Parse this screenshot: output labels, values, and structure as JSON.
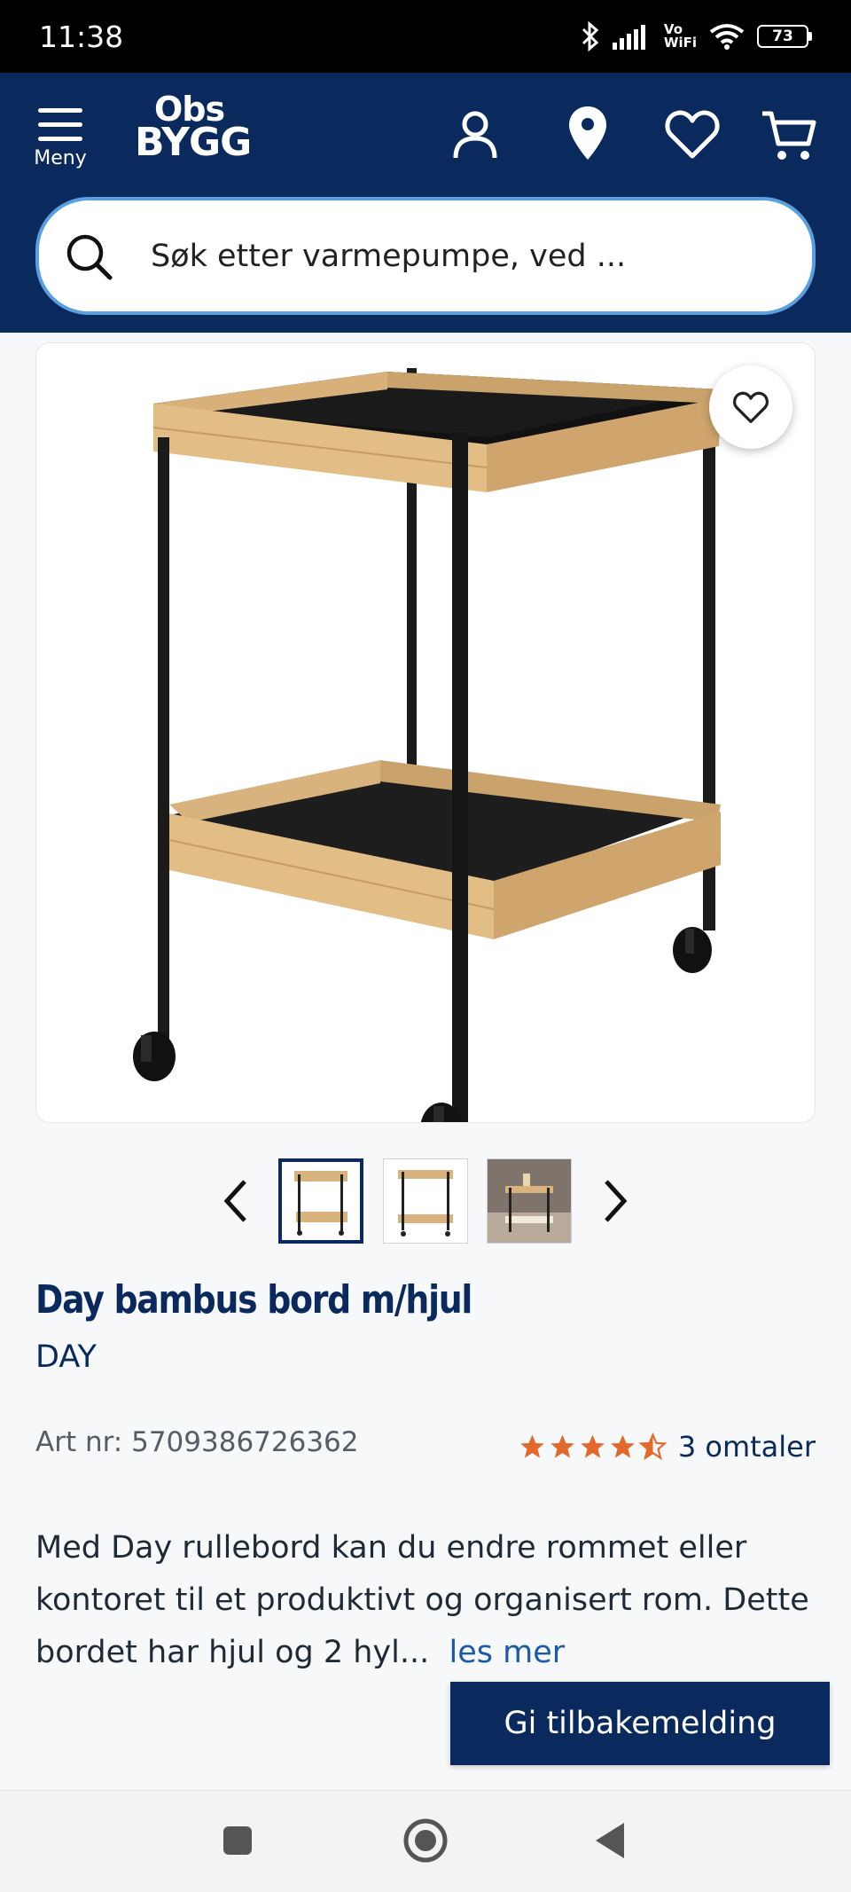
{
  "status_bar": {
    "time": "11:38",
    "network_label_top": "Vo",
    "network_label_bottom": "WiFi",
    "battery": "73"
  },
  "header": {
    "menu_label": "Meny",
    "logo_top": "Obs",
    "logo_bottom": "BYGG",
    "icons": [
      "account-icon",
      "location-pin-icon",
      "heart-icon",
      "cart-icon"
    ],
    "background_color": "#0a2a5e"
  },
  "search": {
    "placeholder": "Søk etter varmepumpe, ved ..."
  },
  "gallery": {
    "thumbnail_count": 3,
    "selected_index": 0
  },
  "product": {
    "title": "Day bambus bord m/hjul",
    "brand": "DAY",
    "art_nr": "Art nr: 5709386726362",
    "rating": 4.5,
    "reviews": "3 omtaler",
    "description": "Med Day rullebord kan du endre rommet eller kontoret til et produktivt og organisert rom. Dette bordet har hjul og 2 hyl...",
    "read_more": "les mer",
    "star_color": "#e2692b"
  },
  "feedback": {
    "label": "Gi tilbakemelding"
  }
}
